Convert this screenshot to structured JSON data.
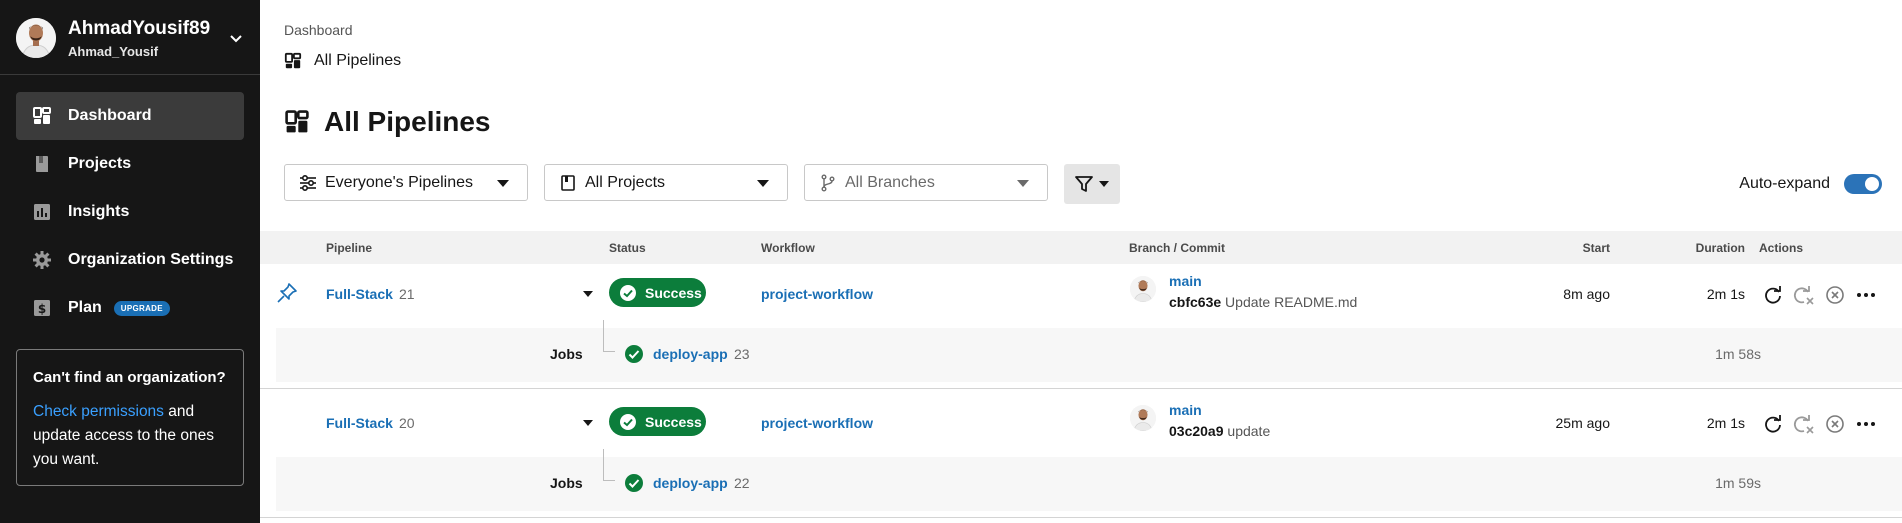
{
  "user": {
    "name": "AhmadYousif89",
    "handle": "Ahmad_Yousif",
    "icon": "chevron-down-icon"
  },
  "sidebar": {
    "items": [
      {
        "label": "Dashboard",
        "icon": "dashboard-icon",
        "active": true
      },
      {
        "label": "Projects",
        "icon": "book-icon"
      },
      {
        "label": "Insights",
        "icon": "chart-icon"
      },
      {
        "label": "Organization Settings",
        "icon": "gear-icon"
      },
      {
        "label": "Plan",
        "icon": "dollar-icon",
        "badge": "UPGRADE"
      }
    ],
    "org_card": {
      "title": "Can't find an organization?",
      "link": "Check permissions",
      "rest": " and update access to the ones you want."
    }
  },
  "breadcrumb": {
    "parent": "Dashboard",
    "current": "All Pipelines"
  },
  "page_title": "All Pipelines",
  "filters": {
    "pipelines": "Everyone's Pipelines",
    "projects": "All Projects",
    "branches": "All Branches",
    "auto_expand": "Auto-expand"
  },
  "table": {
    "headers": {
      "pipeline": "Pipeline",
      "status": "Status",
      "workflow": "Workflow",
      "branch": "Branch / Commit",
      "start": "Start",
      "duration": "Duration",
      "actions": "Actions"
    },
    "rows": [
      {
        "name": "Full-Stack",
        "number": "21",
        "status": "Success",
        "workflow": "project-workflow",
        "branch": "main",
        "sha": "cbfc63e",
        "message": "Update README.md",
        "start": "8m ago",
        "duration": "2m 1s",
        "jobs_label": "Jobs",
        "job": "deploy-app",
        "job_number": "23",
        "job_duration": "1m 58s"
      },
      {
        "name": "Full-Stack",
        "number": "20",
        "status": "Success",
        "workflow": "project-workflow",
        "branch": "main",
        "sha": "03c20a9",
        "message": "update",
        "start": "25m ago",
        "duration": "2m 1s",
        "jobs_label": "Jobs",
        "job": "deploy-app",
        "job_number": "22",
        "job_duration": "1m 59s"
      }
    ]
  },
  "colors": {
    "sidebar": "#161616",
    "link": "#1a6fb5",
    "success": "#0c7d3b",
    "toggle": "#2b73b8",
    "badge": "#1a6fb5"
  }
}
